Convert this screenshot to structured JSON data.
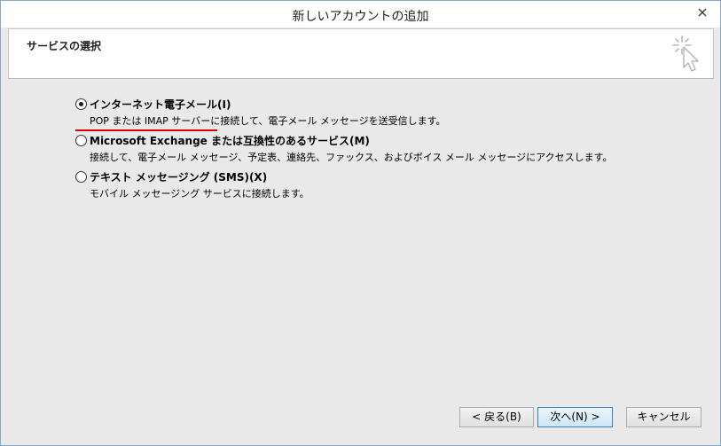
{
  "window": {
    "title": "新しいアカウントの追加"
  },
  "header": {
    "title": "サービスの選択",
    "icon": "sparkle-cursor-icon"
  },
  "options": [
    {
      "label": "インターネット電子メール(I)",
      "description": "POP または IMAP サーバーに接続して、電子メール メッセージを送受信します。",
      "checked": true
    },
    {
      "label": "Microsoft Exchange または互換性のあるサービス(M)",
      "description": "接続して、電子メール メッセージ、予定表、連絡先、ファックス、およびボイス メール メッセージにアクセスします。",
      "checked": false
    },
    {
      "label": "テキスト メッセージング (SMS)(X)",
      "description": "モバイル メッセージング サービスに接続します。",
      "checked": false
    }
  ],
  "buttons": {
    "back": "< 戻る(B)",
    "next": "次へ(N) >",
    "cancel": "キャンセル"
  },
  "colors": {
    "accent_underline": "#d40000",
    "primary_button_border": "#3c7fb1"
  }
}
